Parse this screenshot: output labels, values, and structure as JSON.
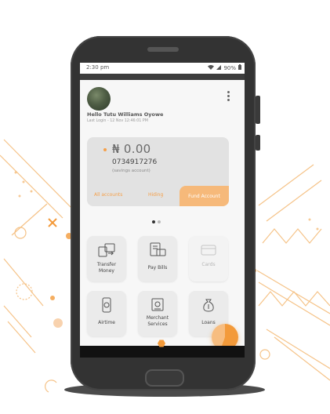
{
  "colors": {
    "accent": "#f39a3a",
    "accent_light": "#f6b97a",
    "phone_body": "#333333",
    "screen_bg": "#f7f7f7"
  },
  "status": {
    "time": "2:30 pm",
    "battery": "90%"
  },
  "profile": {
    "greeting": "Hello Tutu Williams Oyowe",
    "last_login": "Last Login - 12 Nov 12:46:01 PM"
  },
  "account_card": {
    "balance": "₦ 0.00",
    "account_number": "0734917276",
    "account_type": "(savings account)",
    "all_accounts_label": "All accounts",
    "hide_label": "Hiding",
    "fund_button_label": "Fund Account"
  },
  "pager": {
    "pages": 2,
    "active_index": 0
  },
  "services": [
    {
      "label_line1": "Transfer",
      "label_line2": "Money",
      "icon": "transfer-icon",
      "enabled": true
    },
    {
      "label_line1": "Pay Bills",
      "label_line2": "",
      "icon": "bills-icon",
      "enabled": true
    },
    {
      "label_line1": "Cards",
      "label_line2": "",
      "icon": "card-icon",
      "enabled": false
    },
    {
      "label_line1": "Airtime",
      "label_line2": "",
      "icon": "airtime-icon",
      "enabled": true
    },
    {
      "label_line1": "Merchant",
      "label_line2": "Services",
      "icon": "merchant-icon",
      "enabled": true
    },
    {
      "label_line1": "Loans",
      "label_line2": "",
      "icon": "loans-icon",
      "enabled": true
    }
  ]
}
